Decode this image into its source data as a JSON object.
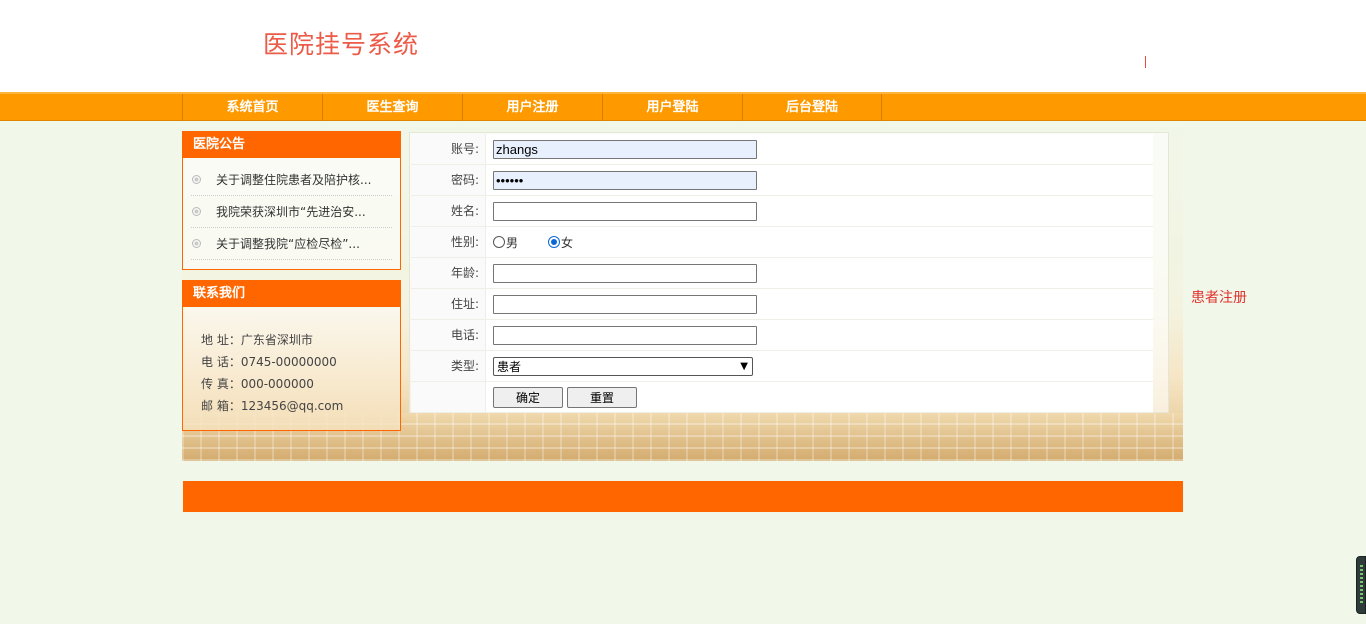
{
  "header": {
    "title": "医院挂号系统"
  },
  "nav": {
    "items": [
      {
        "label": "系统首页"
      },
      {
        "label": "医生查询"
      },
      {
        "label": "用户注册"
      },
      {
        "label": "用户登陆"
      },
      {
        "label": "后台登陆"
      }
    ]
  },
  "notice": {
    "title": "医院公告",
    "items": [
      {
        "text": "关于调整住院患者及陪护核..."
      },
      {
        "text": "我院荣获深圳市“先进治安..."
      },
      {
        "text": "关于调整我院“应检尽检”..."
      }
    ]
  },
  "contact": {
    "title": "联系我们",
    "address": "地 址：广东省深圳市",
    "phone": "电 话：0745-00000000",
    "fax": "传 真：000-000000",
    "email": "邮 箱：123456@qq.com"
  },
  "form": {
    "account_label": "账号:",
    "account_value": "zhangs",
    "password_label": "密码:",
    "password_value": "••••••",
    "name_label": "姓名:",
    "name_value": "",
    "gender_label": "性别:",
    "gender_options": [
      {
        "label": "男",
        "checked": false
      },
      {
        "label": "女",
        "checked": true
      }
    ],
    "age_label": "年龄:",
    "address_label": "住址:",
    "phone_label": "电话:",
    "type_label": "类型:",
    "type_value": "患者",
    "confirm_label": "确定",
    "reset_label": "重置"
  },
  "side_link": "患者注册",
  "colors": {
    "nav": "#ff9900",
    "accent": "#ff6600",
    "title": "#ec5b47",
    "background": "#f1f7e9"
  }
}
